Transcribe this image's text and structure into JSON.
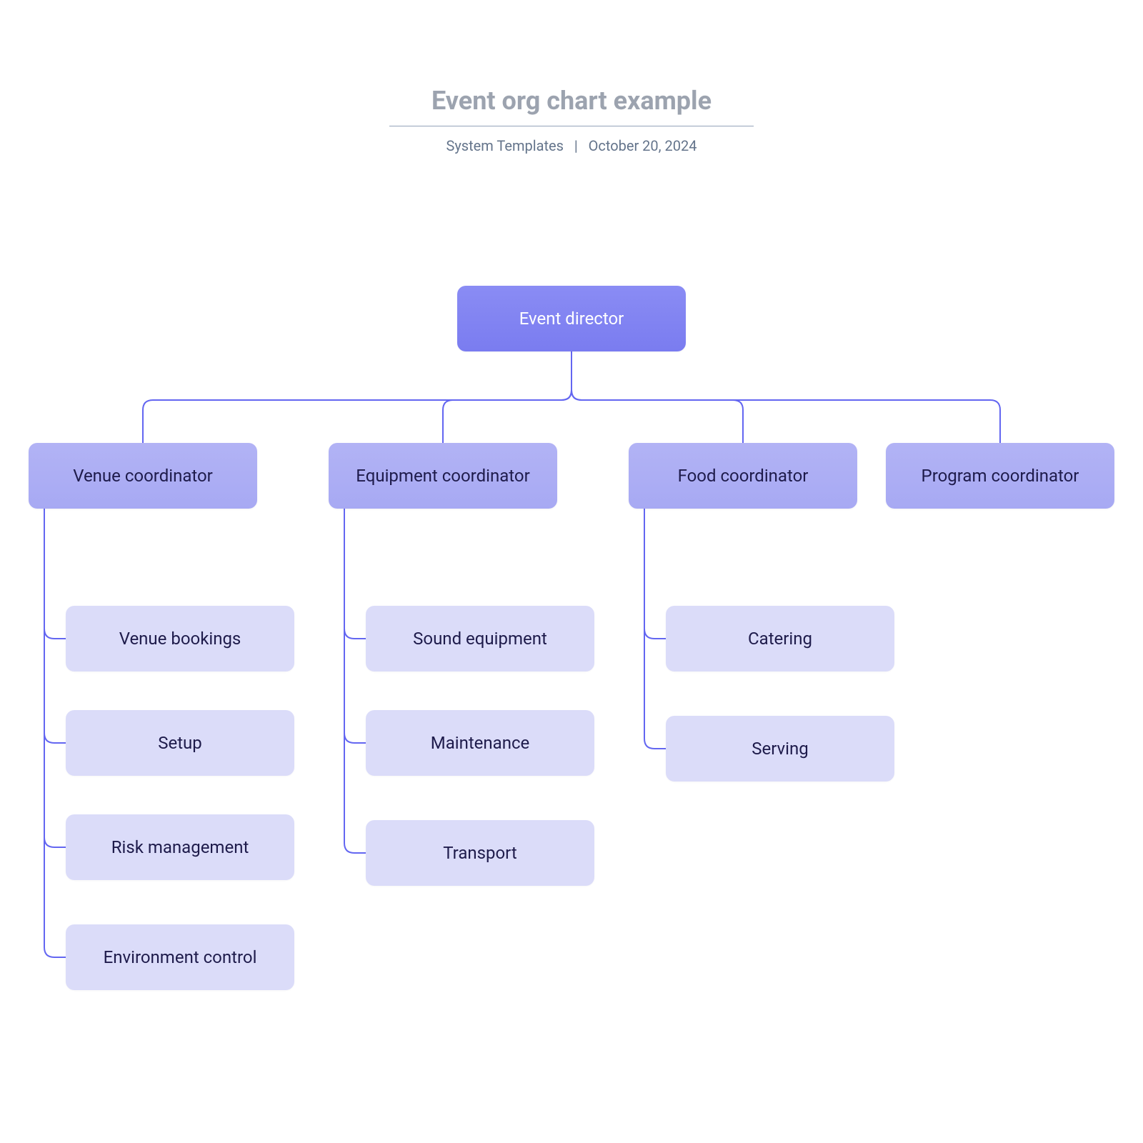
{
  "header": {
    "title": "Event org chart example",
    "source": "System Templates",
    "separator": "|",
    "date": "October 20, 2024"
  },
  "org": {
    "root": {
      "label": "Event director"
    },
    "branches": [
      {
        "label": "Venue coordinator",
        "children": [
          {
            "label": "Venue bookings"
          },
          {
            "label": "Setup"
          },
          {
            "label": "Risk management"
          },
          {
            "label": "Environment control"
          }
        ]
      },
      {
        "label": "Equipment coordinator",
        "children": [
          {
            "label": "Sound equipment"
          },
          {
            "label": "Maintenance"
          },
          {
            "label": "Transport"
          }
        ]
      },
      {
        "label": "Food coordinator",
        "children": [
          {
            "label": "Catering"
          },
          {
            "label": "Serving"
          }
        ]
      },
      {
        "label": "Program coordinator",
        "children": []
      }
    ]
  },
  "colors": {
    "root_bg_top": "#8a8cf4",
    "root_bg_bottom": "#7a7cf0",
    "branch_bg_top": "#b2b3f5",
    "branch_bg_bottom": "#a7a9f3",
    "leaf_bg": "#dbdcf9",
    "connector": "#6366f1",
    "text_dark": "#1e1b4b",
    "text_light": "#ffffff",
    "title_gray": "#9ca3af",
    "subtitle_gray": "#64748b"
  }
}
